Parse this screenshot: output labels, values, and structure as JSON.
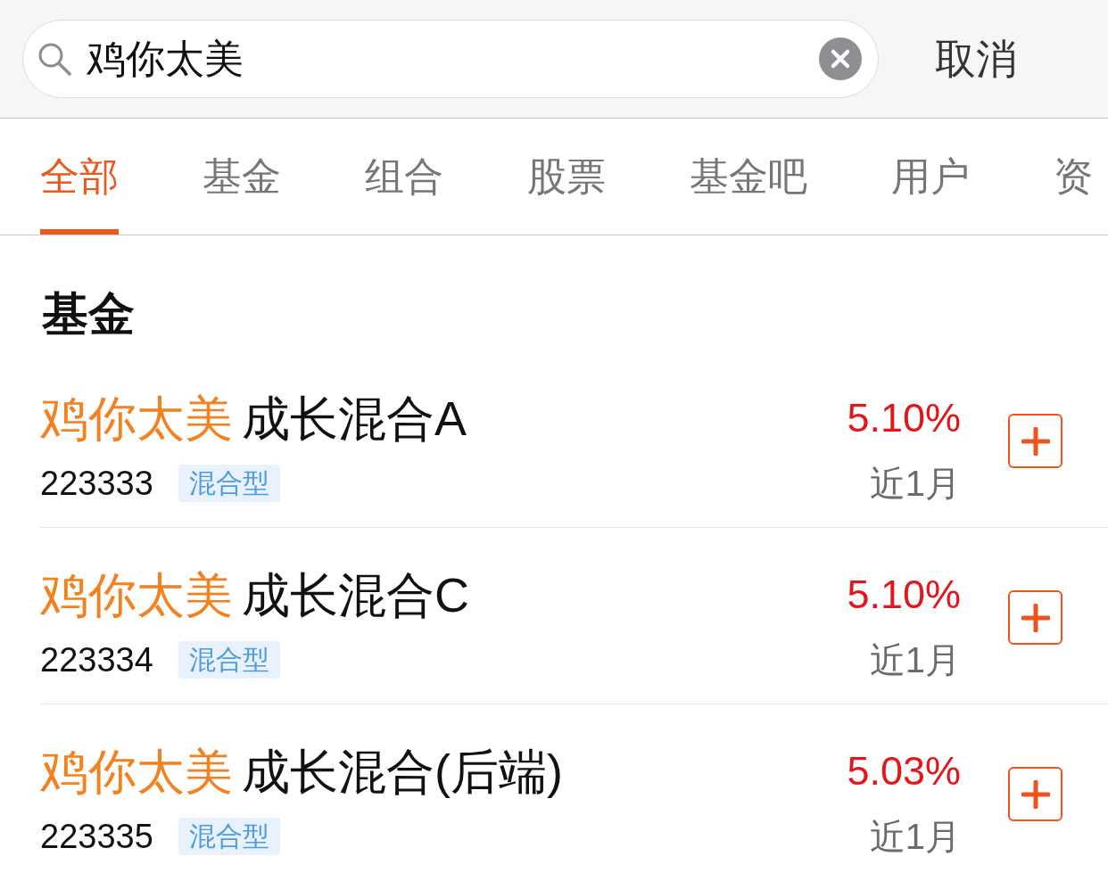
{
  "search": {
    "value": "鸡你太美",
    "cancel": "取消"
  },
  "tabs": [
    {
      "label": "全部",
      "selected": true
    },
    {
      "label": "基金",
      "selected": false
    },
    {
      "label": "组合",
      "selected": false
    },
    {
      "label": "股票",
      "selected": false
    },
    {
      "label": "基金吧",
      "selected": false
    },
    {
      "label": "用户",
      "selected": false
    },
    {
      "label": "资",
      "selected": false
    }
  ],
  "section": {
    "title": "基金",
    "funds": [
      {
        "name_match": "鸡你太美",
        "name_rest": "成长混合A",
        "code": "223333",
        "tag": "混合型",
        "return": "5.10%",
        "period": "近1月"
      },
      {
        "name_match": "鸡你太美",
        "name_rest": "成长混合C",
        "code": "223334",
        "tag": "混合型",
        "return": "5.10%",
        "period": "近1月"
      },
      {
        "name_match": "鸡你太美",
        "name_rest": "成长混合(后端)",
        "code": "223335",
        "tag": "混合型",
        "return": "5.03%",
        "period": "近1月"
      }
    ]
  }
}
